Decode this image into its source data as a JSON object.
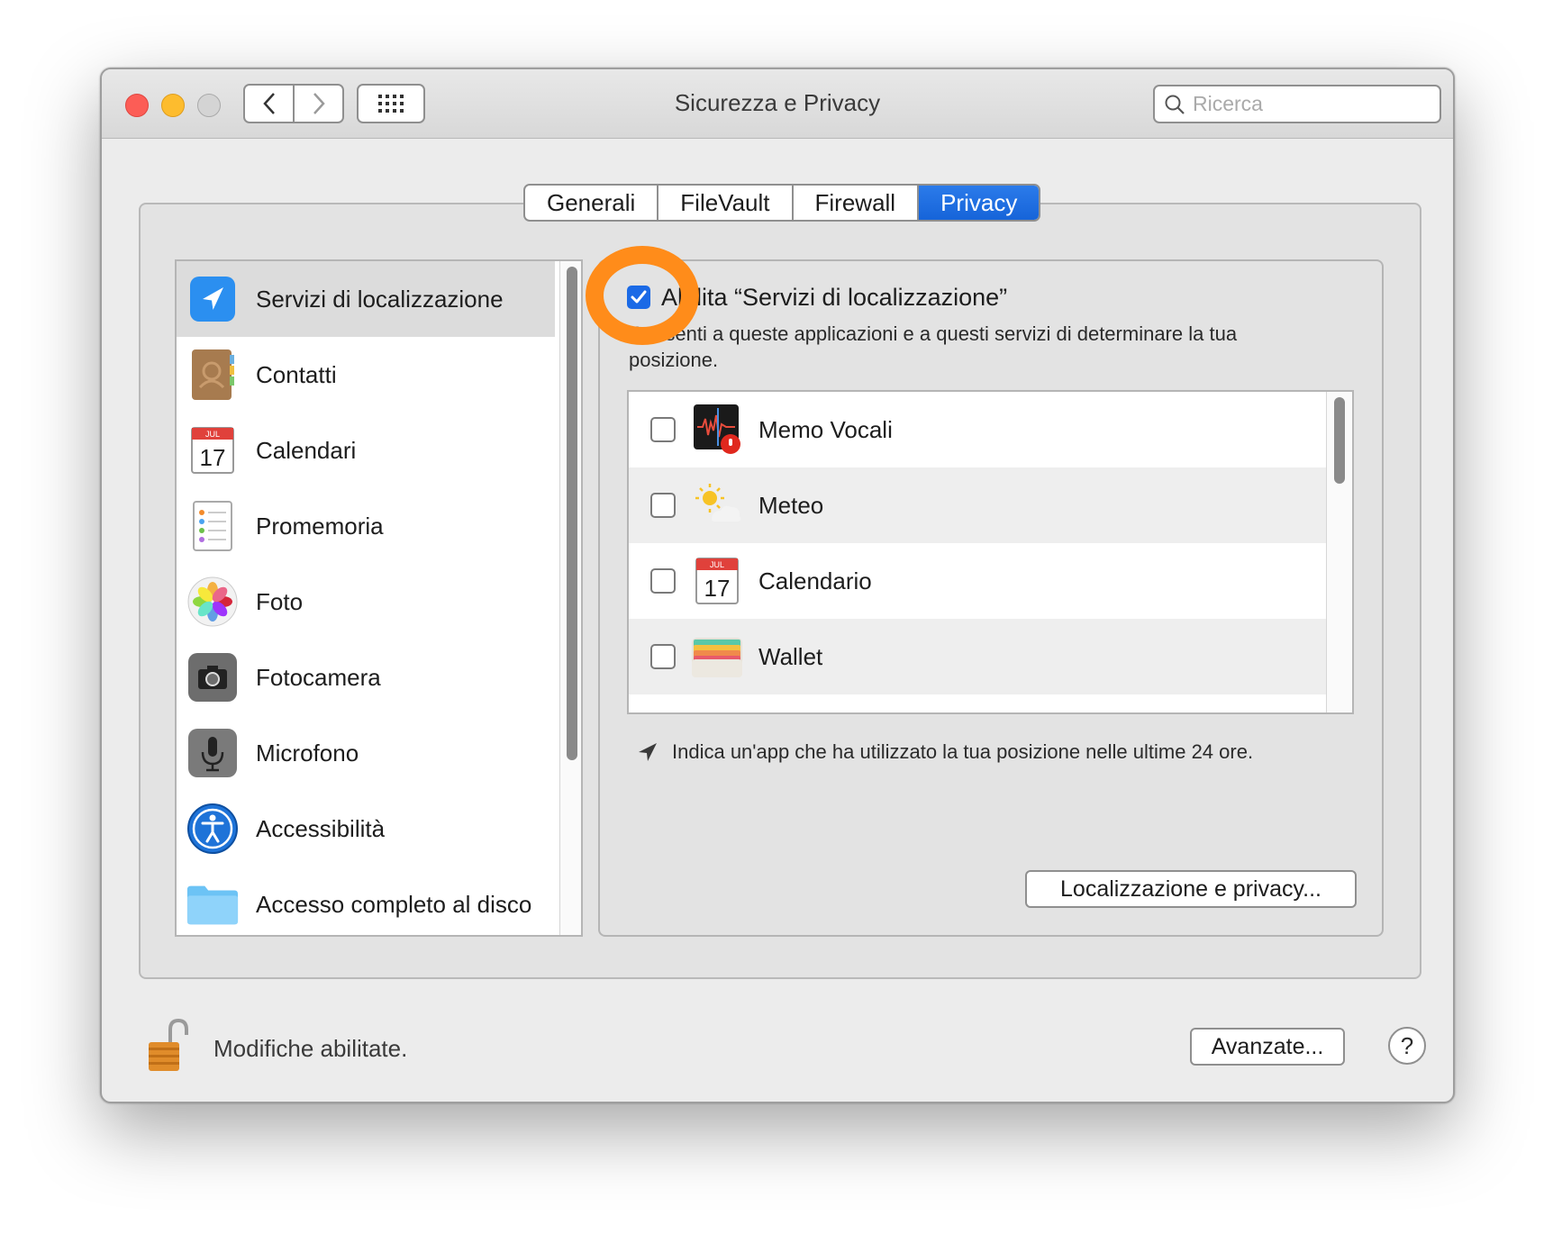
{
  "window": {
    "title": "Sicurezza e Privacy"
  },
  "search": {
    "placeholder": "Ricerca"
  },
  "tabs": [
    {
      "label": "Generali",
      "active": false
    },
    {
      "label": "FileVault",
      "active": false
    },
    {
      "label": "Firewall",
      "active": false
    },
    {
      "label": "Privacy",
      "active": true
    }
  ],
  "sidebar": {
    "items": [
      {
        "label": "Servizi di localizzazione",
        "icon": "location-arrow-icon",
        "selected": true
      },
      {
        "label": "Contatti",
        "icon": "contacts-book-icon",
        "selected": false
      },
      {
        "label": "Calendari",
        "icon": "calendar-icon",
        "selected": false
      },
      {
        "label": "Promemoria",
        "icon": "reminders-icon",
        "selected": false
      },
      {
        "label": "Foto",
        "icon": "photos-icon",
        "selected": false
      },
      {
        "label": "Fotocamera",
        "icon": "camera-icon",
        "selected": false
      },
      {
        "label": "Microfono",
        "icon": "microphone-icon",
        "selected": false
      },
      {
        "label": "Accessibilità",
        "icon": "accessibility-icon",
        "selected": false
      },
      {
        "label": "Accesso completo al disco",
        "icon": "folder-icon",
        "selected": false
      }
    ]
  },
  "privacy": {
    "enable_label": "Abilita “Servizi di localizzazione”",
    "enable_checked": true,
    "description": "Consenti a queste applicazioni e a questi servizi di determinare la tua posizione.",
    "apps": [
      {
        "name": "Memo Vocali",
        "icon": "voice-memos-icon",
        "checked": false
      },
      {
        "name": "Meteo",
        "icon": "weather-icon",
        "checked": false
      },
      {
        "name": "Calendario",
        "icon": "calendar-icon",
        "checked": false
      },
      {
        "name": "Wallet",
        "icon": "wallet-icon",
        "checked": false
      }
    ],
    "calendar_month": "JUL",
    "calendar_day": "17",
    "note": "Indica un'app che ha utilizzato la tua posizione nelle ultime 24 ore.",
    "details_button": "Localizzazione e privacy..."
  },
  "footer": {
    "lock_text": "Modifiche abilitate.",
    "advanced_button": "Avanzate...",
    "help_label": "?"
  },
  "colors": {
    "accent": "#1b6ae6",
    "highlight": "#ff8c1a",
    "selection": "#dcdcdc"
  }
}
